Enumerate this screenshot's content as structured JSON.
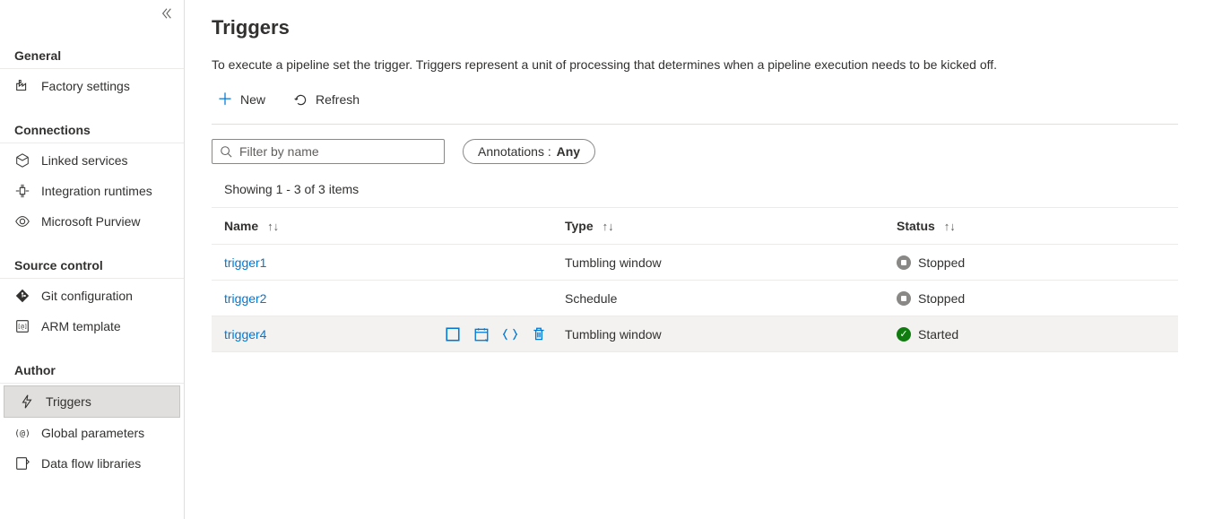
{
  "sidebar": {
    "sections": [
      {
        "key": "general",
        "label": "General",
        "items": [
          {
            "key": "factory-settings",
            "label": "Factory settings",
            "icon": "factory"
          }
        ]
      },
      {
        "key": "connections",
        "label": "Connections",
        "items": [
          {
            "key": "linked-services",
            "label": "Linked services",
            "icon": "linked"
          },
          {
            "key": "integration-runtimes",
            "label": "Integration runtimes",
            "icon": "runtimes"
          },
          {
            "key": "microsoft-purview",
            "label": "Microsoft Purview",
            "icon": "purview"
          }
        ]
      },
      {
        "key": "source-control",
        "label": "Source control",
        "items": [
          {
            "key": "git-configuration",
            "label": "Git configuration",
            "icon": "git"
          },
          {
            "key": "arm-template",
            "label": "ARM template",
            "icon": "arm"
          }
        ]
      },
      {
        "key": "author",
        "label": "Author",
        "items": [
          {
            "key": "triggers",
            "label": "Triggers",
            "icon": "trigger",
            "active": true
          },
          {
            "key": "global-parameters",
            "label": "Global parameters",
            "icon": "params"
          },
          {
            "key": "data-flow-libraries",
            "label": "Data flow libraries",
            "icon": "dataflow"
          }
        ]
      }
    ]
  },
  "page": {
    "title": "Triggers",
    "description": "To execute a pipeline set the trigger. Triggers represent a unit of processing that determines when a pipeline execution needs to be kicked off."
  },
  "toolbar": {
    "new_label": "New",
    "refresh_label": "Refresh"
  },
  "filter": {
    "search_placeholder": "Filter by name",
    "annotations_label": "Annotations :",
    "annotations_value": "Any"
  },
  "results": {
    "count_text": "Showing 1 - 3 of 3 items"
  },
  "table": {
    "columns": {
      "name": "Name",
      "type": "Type",
      "status": "Status"
    },
    "rows": [
      {
        "name": "trigger1",
        "type": "Tumbling window",
        "status": "Stopped",
        "hovered": false
      },
      {
        "name": "trigger2",
        "type": "Schedule",
        "status": "Stopped",
        "hovered": false
      },
      {
        "name": "trigger4",
        "type": "Tumbling window",
        "status": "Started",
        "hovered": true
      }
    ]
  }
}
